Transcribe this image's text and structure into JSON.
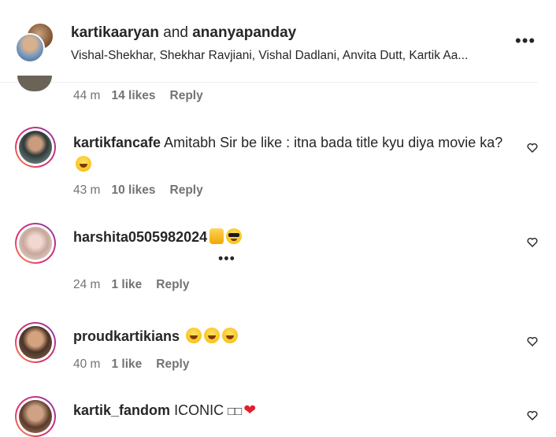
{
  "header": {
    "user1": "kartikaaryan",
    "joiner": "and",
    "user2": "ananyapanday",
    "subtitle": "Vishal-Shekhar, Shekhar Ravjiani, Vishal Dadlani, Anvita Dutt, Kartik Aa..."
  },
  "partial_comment": {
    "time": "44 m",
    "likes": "14 likes",
    "reply": "Reply"
  },
  "comments": [
    {
      "username": "kartikfancafe",
      "text": "Amitabh Sir be like : itna bada title kyu diya movie ka?",
      "emojis": [
        "laugh"
      ],
      "time": "43 m",
      "likes": "10 likes",
      "reply": "Reply"
    },
    {
      "username": "harshita0505982024",
      "text": "",
      "emojis": [
        "thumbs-up",
        "sunglasses"
      ],
      "time": "24 m",
      "likes": "1 like",
      "reply": "Reply"
    },
    {
      "username": "proudkartikians",
      "text": "",
      "emojis": [
        "laugh",
        "laugh",
        "laugh"
      ],
      "time": "40 m",
      "likes": "1 like",
      "reply": "Reply"
    },
    {
      "username": "kartik_fandom",
      "text": "ICONIC",
      "glyphs": "□□",
      "emojis": [
        "red-heart"
      ]
    }
  ],
  "colors": {
    "text": "#262626",
    "muted": "#737373",
    "ring": "#e1306c"
  }
}
